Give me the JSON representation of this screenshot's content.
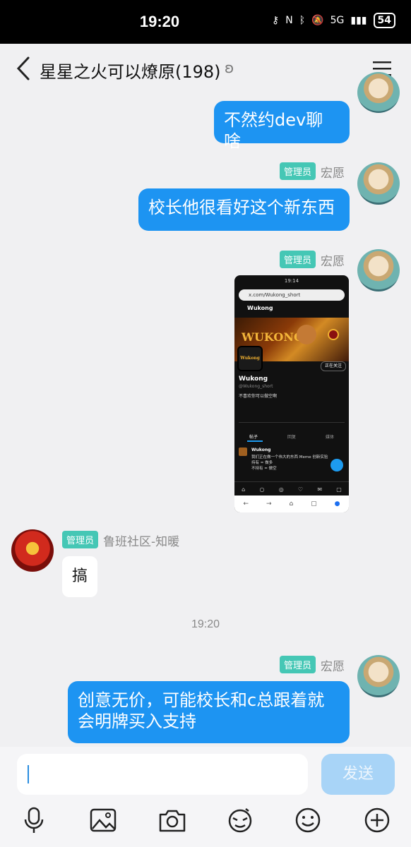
{
  "status": {
    "time": "19:20",
    "battery": "54",
    "network": "5G"
  },
  "header": {
    "title": "星星之火可以燎原(198)",
    "ear_icon": "ear-icon",
    "menu_icon": "menu-icon"
  },
  "messages": [
    {
      "text": "不然约dev聊啥"
    },
    {
      "badge": "管理员",
      "name": "宏愿",
      "text": "校长他很看好这个新东西"
    },
    {
      "badge": "管理员",
      "name": "宏愿",
      "image_label": "Wukong",
      "image_handle": "@Wukong_short"
    },
    {
      "badge": "管理员",
      "name": "鲁班社区-知暖",
      "text": "搞"
    },
    {
      "badge": "管理员",
      "name": "宏愿",
      "text": "创意无价，可能校长和c总跟着就会明牌买入支持"
    }
  ],
  "timestamp": "19:20",
  "screenshot": {
    "url": "x.com/Wukong_short",
    "time": "19:14",
    "name": "Wukong",
    "handle": "@Wukong_short",
    "bio": "不喜欢你可以做空啊",
    "follow": "正在关注",
    "tabs": [
      "帖子",
      "回复",
      "媒体"
    ],
    "tweet": "我们正在做一个伟大的东西 Meme 创新实验",
    "tweet2": "持有 = 做多",
    "tweet3": "不持有 = 做空"
  },
  "composer": {
    "placeholder": "",
    "send_label": "发送"
  },
  "toolbar": [
    "mic-icon",
    "image-icon",
    "camera-icon",
    "sticker-icon",
    "emoji-icon",
    "plus-icon"
  ]
}
